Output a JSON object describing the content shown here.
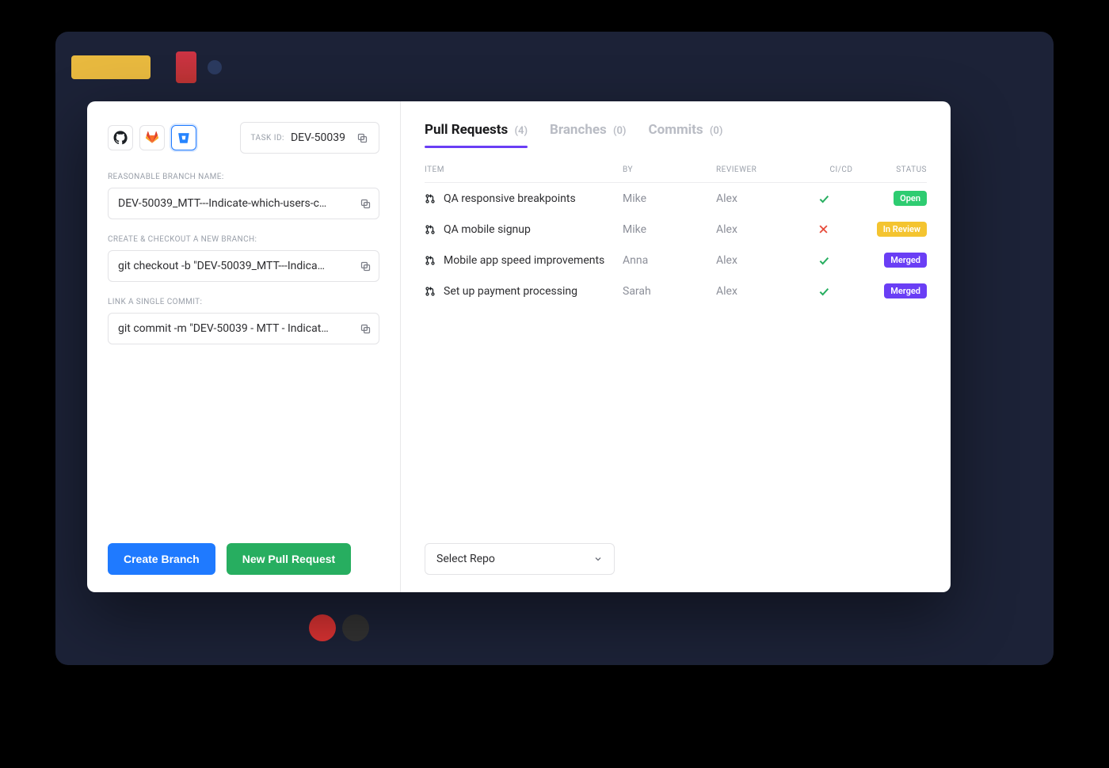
{
  "left": {
    "task_id_label": "TASK ID:",
    "task_id": "DEV-50039",
    "branch_name_label": "REASONABLE BRANCH NAME:",
    "branch_name": "DEV-50039_MTT---Indicate-which-users-c…",
    "checkout_label": "CREATE & CHECKOUT A NEW BRANCH:",
    "checkout_cmd": "git checkout -b \"DEV-50039_MTT---Indica…",
    "commit_label": "LINK A SINGLE COMMIT:",
    "commit_cmd": "git commit -m \"DEV-50039 - MTT - Indicat…",
    "create_branch_btn": "Create Branch",
    "new_pr_btn": "New Pull Request"
  },
  "tabs": {
    "pull_requests": {
      "label": "Pull Requests",
      "count": "(4)"
    },
    "branches": {
      "label": "Branches",
      "count": "(0)"
    },
    "commits": {
      "label": "Commits",
      "count": "(0)"
    }
  },
  "table": {
    "headers": {
      "item": "ITEM",
      "by": "BY",
      "reviewer": "REVIEWER",
      "cicd": "CI/CD",
      "status": "STATUS"
    },
    "rows": [
      {
        "item": "QA responsive breakpoints",
        "by": "Mike",
        "reviewer": "Alex",
        "ci": "pass",
        "status": "Open",
        "status_class": "badge-open"
      },
      {
        "item": "QA mobile signup",
        "by": "Mike",
        "reviewer": "Alex",
        "ci": "fail",
        "status": "In Review",
        "status_class": "badge-review"
      },
      {
        "item": "Mobile app speed improvements",
        "by": "Anna",
        "reviewer": "Alex",
        "ci": "pass",
        "status": "Merged",
        "status_class": "badge-merged"
      },
      {
        "item": "Set up payment processing",
        "by": "Sarah",
        "reviewer": "Alex",
        "ci": "pass",
        "status": "Merged",
        "status_class": "badge-merged"
      }
    ]
  },
  "select_repo": "Select Repo"
}
